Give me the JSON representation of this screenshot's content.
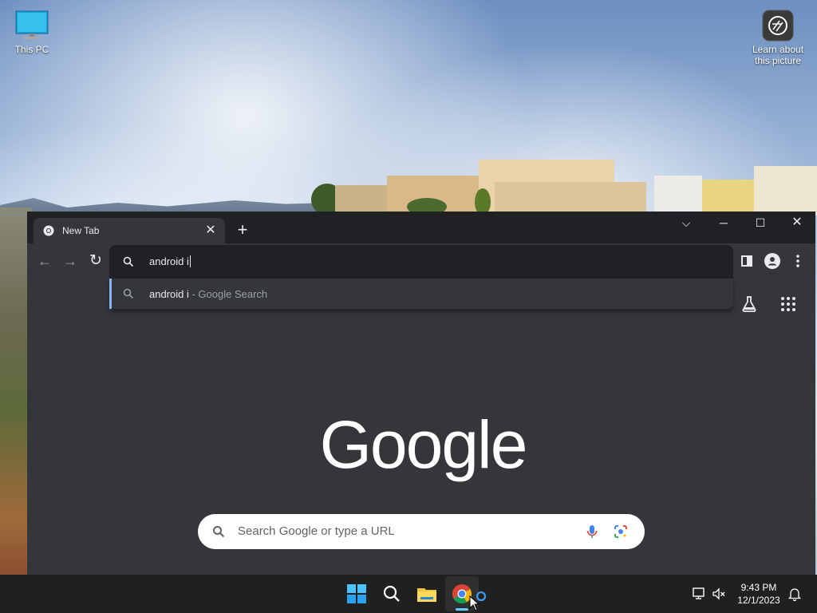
{
  "desktop": {
    "icons": [
      {
        "label": "This PC"
      },
      {
        "label": "Learn about this picture"
      }
    ]
  },
  "browser": {
    "tab": {
      "title": "New Tab"
    },
    "omnibox": {
      "value": "android i"
    },
    "suggestion": {
      "text": "android i",
      "subtext": " - Google Search"
    },
    "ntp": {
      "logo": "Google",
      "search_placeholder": "Search Google or type a URL"
    }
  },
  "taskbar": {
    "clock": {
      "time": "9:43 PM",
      "date": "12/1/2023"
    }
  },
  "colors": {
    "accent": "#8ab4f8",
    "browser_bg": "#35363a",
    "taskbar_bg": "#202020",
    "taskbar_highlight": "#60cdff"
  }
}
